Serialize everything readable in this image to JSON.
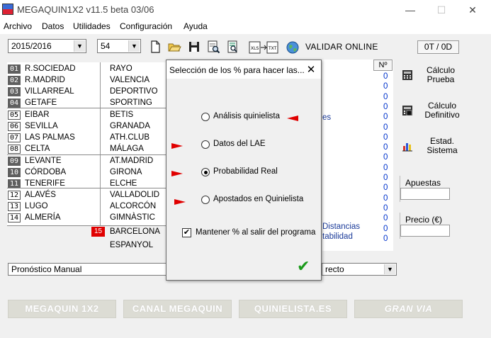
{
  "window": {
    "title": "MEGAQUIN1X2 v11.5 beta 03/06",
    "minimize": "—",
    "maximize": "☐",
    "close": "✕"
  },
  "menu": [
    "Archivo",
    "Datos",
    "Utilidades",
    "Configuración",
    "Ayuda"
  ],
  "toolbar": {
    "season": "2015/2016",
    "jornada": "54",
    "validar_label": "VALIDAR ONLINE",
    "counter": "0T / 0D",
    "icons": [
      "new-file-icon",
      "open-folder-icon",
      "save-disk-icon",
      "print-preview-icon",
      "document-search-icon",
      "import-export-icon",
      "globe-icon"
    ]
  },
  "matches": [
    {
      "num": "01",
      "home": "R.SOCIEDAD",
      "away": "RAYO"
    },
    {
      "num": "02",
      "home": "R.MADRID",
      "away": "VALENCIA"
    },
    {
      "num": "03",
      "home": "VILLARREAL",
      "away": "DEPORTIVO"
    },
    {
      "num": "04",
      "home": "GETAFE",
      "away": "SPORTING"
    },
    {
      "num": "05",
      "home": "EIBAR",
      "away": "BETIS"
    },
    {
      "num": "06",
      "home": "SEVILLA",
      "away": "GRANADA"
    },
    {
      "num": "07",
      "home": "LAS PALMAS",
      "away": "ATH.CLUB"
    },
    {
      "num": "08",
      "home": "CELTA",
      "away": "MÁLAGA"
    },
    {
      "num": "09",
      "home": "LEVANTE",
      "away": "AT.MADRID"
    },
    {
      "num": "10",
      "home": "CÓRDOBA",
      "away": "GIRONA"
    },
    {
      "num": "11",
      "home": "TENERIFE",
      "away": "ELCHE"
    },
    {
      "num": "12",
      "home": "ALAVÉS",
      "away": "VALLADOLID"
    },
    {
      "num": "13",
      "home": "LUGO",
      "away": "ALCORCÓN"
    },
    {
      "num": "14",
      "home": "ALMERÍA",
      "away": "GIMNÀSTIC"
    }
  ],
  "pleno": {
    "num": "15",
    "home": "BARCELONA",
    "away": "ESPANYOL"
  },
  "grid": {
    "header": "Nº",
    "values": [
      "0",
      "0",
      "0",
      "0",
      "0",
      "0",
      "0",
      "0",
      "0",
      "0",
      "0",
      "0",
      "0",
      "0",
      "0",
      "0",
      "0"
    ],
    "partial_labels": [
      "es",
      "Distancias",
      "tabilidad"
    ]
  },
  "side": {
    "calc_prueba": "Cálculo Prueba",
    "calc_definitivo": "Cálculo Definitivo",
    "estad_sistema": "Estad. Sistema",
    "apuestas_label": "Apuestas",
    "apuestas_value": "",
    "precio_label": "Precio (€)",
    "precio_value": ""
  },
  "bottom": {
    "pronostico": "Pronóstico Manual",
    "right_combo": "recto"
  },
  "footer": [
    "MEGAQUIN 1X2",
    "CANAL MEGAQUIN",
    "QUINIELISTA.ES",
    "GRAN VIA"
  ],
  "dialog": {
    "title": "Selección de los % para hacer las...",
    "close": "✕",
    "options": [
      {
        "label": "Análisis quinielista",
        "checked": false
      },
      {
        "label": "Datos del LAE",
        "checked": false
      },
      {
        "label": "Probabilidad Real",
        "checked": true
      },
      {
        "label": "Apostados en Quinielista",
        "checked": false
      }
    ],
    "keep_label": "Mantener % al salir del programa",
    "keep_checked": true,
    "ok": "✔"
  },
  "colors": {
    "arrow": "#e00000",
    "pleno_badge": "#e00000",
    "ok_check": "#1a9a1a",
    "zero_text": "#0033cc"
  }
}
